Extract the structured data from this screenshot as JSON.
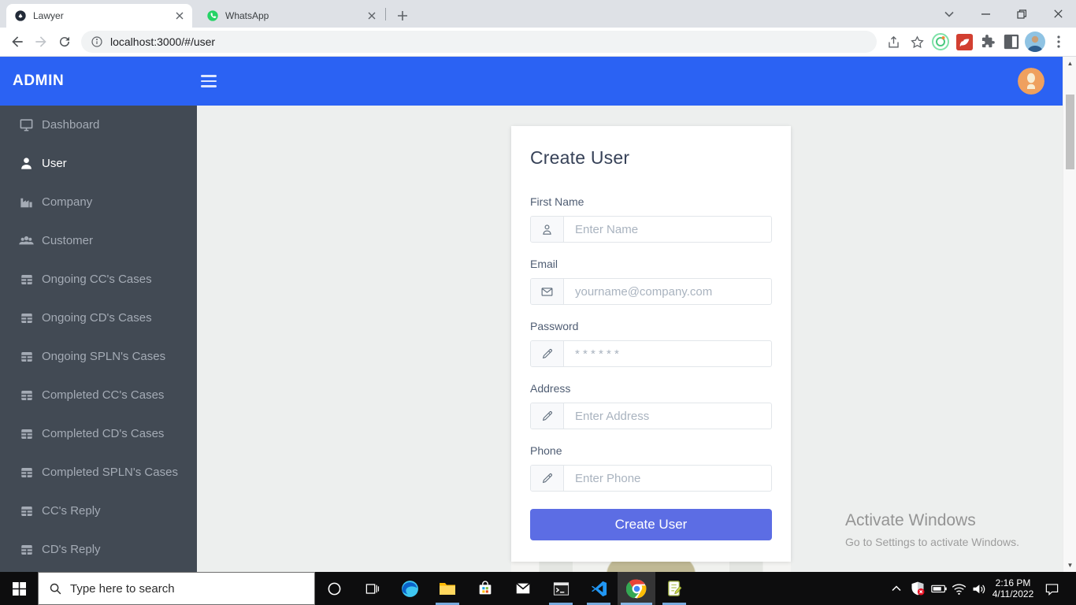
{
  "browser": {
    "tabs": [
      {
        "title": "Lawyer"
      },
      {
        "title": "WhatsApp"
      }
    ],
    "url": "localhost:3000/#/user"
  },
  "header": {
    "brand": "ADMIN"
  },
  "sidebar": {
    "items": [
      {
        "label": "Dashboard",
        "icon": "monitor",
        "active": false
      },
      {
        "label": "User",
        "icon": "person",
        "active": true
      },
      {
        "label": "Company",
        "icon": "factory",
        "active": false
      },
      {
        "label": "Customer",
        "icon": "people",
        "active": false
      },
      {
        "label": "Ongoing CC's Cases",
        "icon": "table",
        "active": false
      },
      {
        "label": "Ongoing CD's Cases",
        "icon": "table",
        "active": false
      },
      {
        "label": "Ongoing SPLN's Cases",
        "icon": "table",
        "active": false
      },
      {
        "label": "Completed CC's Cases",
        "icon": "table",
        "active": false
      },
      {
        "label": "Completed CD's Cases",
        "icon": "table",
        "active": false
      },
      {
        "label": "Completed SPLN's Cases",
        "icon": "table",
        "active": false
      },
      {
        "label": "CC's Reply",
        "icon": "table",
        "active": false
      },
      {
        "label": "CD's Reply",
        "icon": "table",
        "active": false
      }
    ]
  },
  "form": {
    "title": "Create User",
    "fields": [
      {
        "label": "First Name",
        "placeholder": "Enter Name",
        "icon": "person-outline"
      },
      {
        "label": "Email",
        "placeholder": "yourname@company.com",
        "icon": "envelope"
      },
      {
        "label": "Password",
        "placeholder": "* * * * * *",
        "icon": "pencil"
      },
      {
        "label": "Address",
        "placeholder": "Enter Address",
        "icon": "pencil"
      },
      {
        "label": "Phone",
        "placeholder": "Enter Phone",
        "icon": "pencil"
      }
    ],
    "submit_label": "Create User"
  },
  "watermark": {
    "title": "Activate Windows",
    "subtitle": "Go to Settings to activate Windows."
  },
  "taskbar": {
    "search_placeholder": "Type here to search",
    "time": "2:16 PM",
    "date": "4/11/2022"
  },
  "colors": {
    "header_blue": "#2b62f3",
    "sidebar_dark": "#424a54",
    "button_primary": "#5c6de4",
    "whatsapp_green": "#25d366"
  }
}
